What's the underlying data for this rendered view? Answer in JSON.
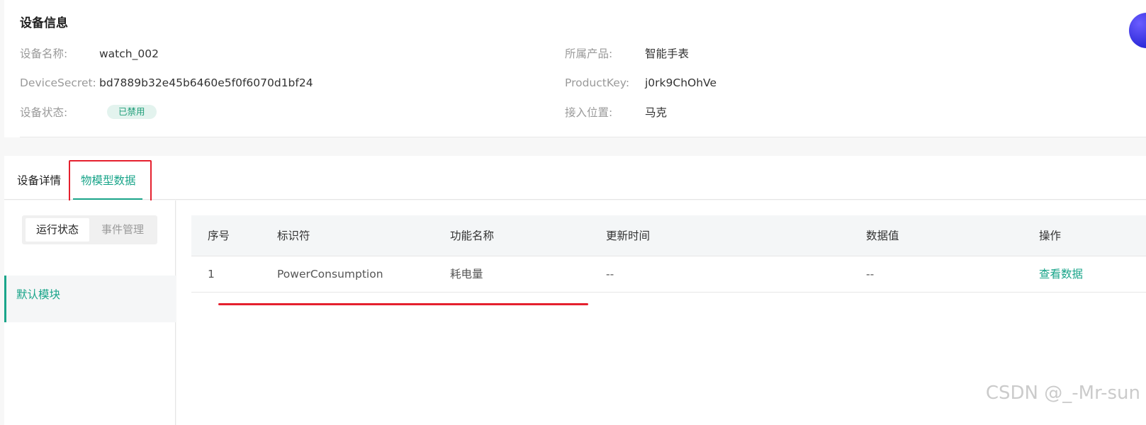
{
  "device_info": {
    "title": "设备信息",
    "fields": {
      "name_label": "设备名称:",
      "name_value": "watch_002",
      "product_label": "所属产品:",
      "product_value": "智能手表",
      "secret_label": "DeviceSecret:",
      "secret_value": "bd7889b32e45b6460e5f0f6070d1bf24",
      "key_label": "ProductKey:",
      "key_value": "j0rk9ChOhVe",
      "status_label": "设备状态:",
      "status_value": "已禁用",
      "location_label": "接入位置:",
      "location_value": "马克"
    }
  },
  "tabs": {
    "details": "设备详情",
    "thing_model": "物模型数据"
  },
  "segment": {
    "running": "运行状态",
    "events": "事件管理"
  },
  "module": {
    "default": "默认模块"
  },
  "table": {
    "headers": [
      "序号",
      "标识符",
      "功能名称",
      "更新时间",
      "数据值",
      "操作"
    ],
    "rows": [
      [
        "1",
        "PowerConsumption",
        "耗电量",
        "--",
        "--",
        "查看数据"
      ]
    ]
  },
  "watermark": "CSDN @_-Mr-sun",
  "colors": {
    "accent": "#1aa58a",
    "annotation_red": "#e5202e",
    "status_badge_bg": "#e3f3ee"
  }
}
